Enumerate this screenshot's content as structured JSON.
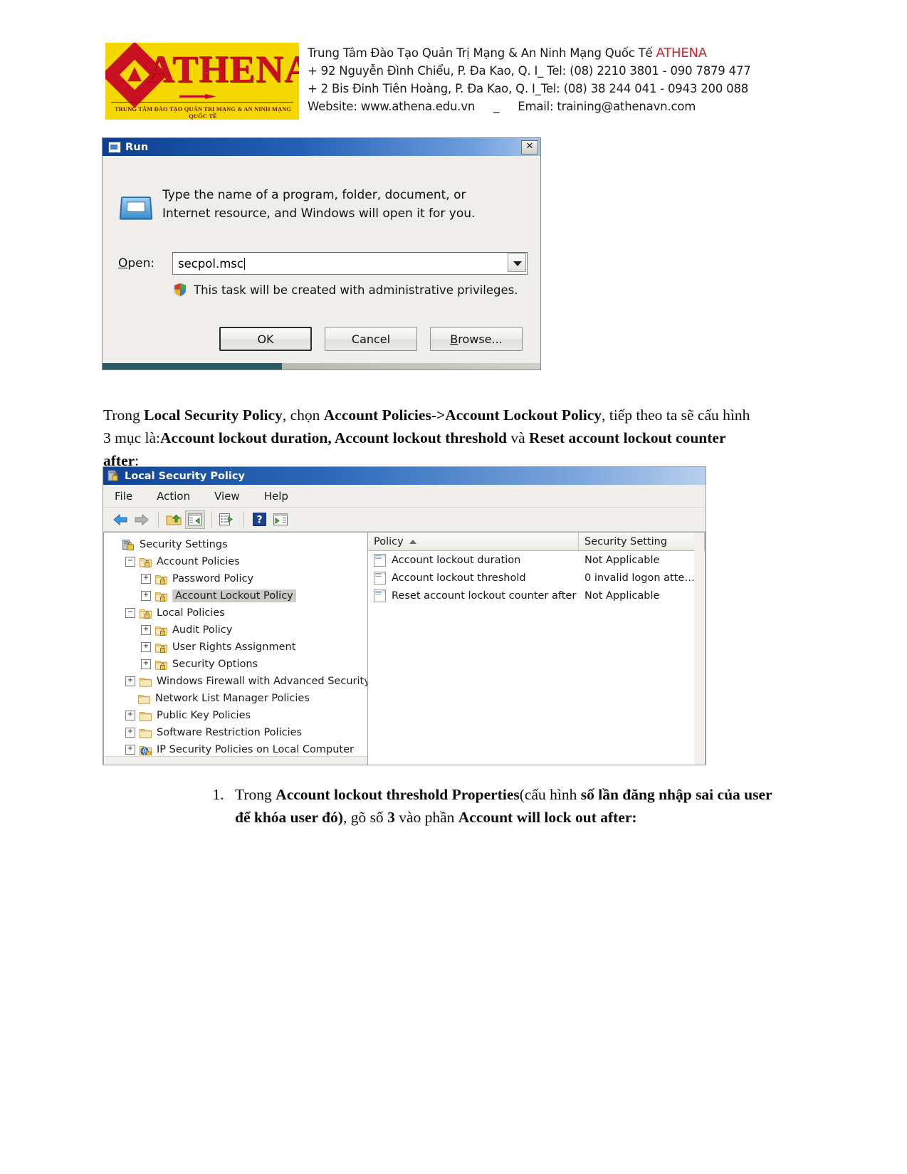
{
  "letterhead": {
    "logo": {
      "wordmark": "ATHENA",
      "tagline": "TRUNG TÂM ĐÀO TẠO QUẢN TRỊ MẠNG & AN NINH MẠNG QUỐC TẾ",
      "brand_color": "#c81020",
      "background_color": "#f5d800"
    },
    "line1_prefix": "Trung Tâm Đào Tạo Quản Trị Mạng & An Ninh Mạng Quốc Tế ",
    "line1_brand": "ATHENA",
    "line2": "+ 92 Nguyễn Đình Chiểu, P. Đa Kao, Q. I_ Tel: (08) 2210 3801 -  090 7879 477",
    "line3": "+ 2 Bis Đinh Tiên Hoàng, P. Đa Kao, Q. I_Tel: (08) 38 244 041 - 0943 200 088",
    "line4_website": "Website: www.athena.edu.vn",
    "line4_sep": "_",
    "line4_email": "Email: training@athenavn.com"
  },
  "run_dialog": {
    "title": "Run",
    "close_label": "✕",
    "description": "Type the name of a program, folder, document, or Internet resource, and Windows will open it for you.",
    "open_label_pre": "O",
    "open_label_post": "pen:",
    "open_value": "secpol.msc",
    "uac_text": "This task will be created with administrative privileges.",
    "buttons": {
      "ok": "OK",
      "cancel": "Cancel",
      "browse_pre": "B",
      "browse_post": "rowse..."
    }
  },
  "paragraph1": {
    "t1": "Trong ",
    "b1": "Local Security Policy",
    "t2": ", chọn ",
    "b2": "Account Policies->Account Lockout Policy",
    "t3": ", tiếp theo ta sẽ cấu hình 3 mục là:",
    "b3": "Account lockout duration, Account lockout threshold",
    "t4": " và ",
    "b4": "Reset account lockout counter after",
    "t5": ":"
  },
  "lsp_window": {
    "title": "Local Security Policy",
    "menus": [
      "File",
      "Action",
      "View",
      "Help"
    ],
    "toolbar": [
      {
        "name": "back-icon",
        "label": "Back"
      },
      {
        "name": "forward-icon",
        "label": "Forward"
      },
      {
        "name": "up-folder-icon",
        "label": "Up One Level"
      },
      {
        "name": "show-hide-tree-icon",
        "label": "Show/Hide Console Tree"
      },
      {
        "name": "export-list-icon",
        "label": "Export List"
      },
      {
        "name": "help-icon",
        "label": "Help"
      },
      {
        "name": "show-action-pane-icon",
        "label": "Show/Hide Action Pane"
      }
    ],
    "tree": [
      {
        "label": "Security Settings",
        "indent": 0,
        "toggle": "none",
        "icon": "root",
        "selected": false
      },
      {
        "label": "Account Policies",
        "indent": 1,
        "toggle": "minus",
        "icon": "policy-folder",
        "selected": false
      },
      {
        "label": "Password Policy",
        "indent": 2,
        "toggle": "plus",
        "icon": "policy-folder",
        "selected": false
      },
      {
        "label": "Account Lockout Policy",
        "indent": 2,
        "toggle": "plus",
        "icon": "policy-folder",
        "selected": true
      },
      {
        "label": "Local Policies",
        "indent": 1,
        "toggle": "minus",
        "icon": "policy-folder",
        "selected": false
      },
      {
        "label": "Audit Policy",
        "indent": 2,
        "toggle": "plus",
        "icon": "policy-folder",
        "selected": false
      },
      {
        "label": "User Rights Assignment",
        "indent": 2,
        "toggle": "plus",
        "icon": "policy-folder",
        "selected": false
      },
      {
        "label": "Security Options",
        "indent": 2,
        "toggle": "plus",
        "icon": "policy-folder",
        "selected": false
      },
      {
        "label": "Windows Firewall with Advanced Security",
        "indent": 1,
        "toggle": "plus",
        "icon": "plain-folder",
        "selected": false
      },
      {
        "label": "Network List Manager Policies",
        "indent": 1,
        "toggle": "none",
        "icon": "plain-folder",
        "selected": false
      },
      {
        "label": "Public Key Policies",
        "indent": 1,
        "toggle": "plus",
        "icon": "plain-folder",
        "selected": false
      },
      {
        "label": "Software Restriction Policies",
        "indent": 1,
        "toggle": "plus",
        "icon": "plain-folder",
        "selected": false
      },
      {
        "label": "IP Security Policies on Local Computer",
        "indent": 1,
        "toggle": "plus",
        "icon": "ipsec-folder",
        "selected": false
      }
    ],
    "list": {
      "columns": [
        "Policy",
        "Security Setting"
      ],
      "sort_column": "Policy",
      "sort_direction": "asc",
      "rows": [
        {
          "policy": "Account lockout duration",
          "setting": "Not Applicable"
        },
        {
          "policy": "Account lockout threshold",
          "setting": "0 invalid logon atte…"
        },
        {
          "policy": "Reset account lockout counter after",
          "setting": "Not Applicable"
        }
      ]
    }
  },
  "numbered_list": [
    {
      "number": "1.",
      "t1": "Trong ",
      "b1": "Account lockout threshold Properties",
      "t2": "(cấu hình ",
      "b2": "số lần đăng nhập sai của user để khóa user đó)",
      "t3": ", gõ số ",
      "b3": "3",
      "t4": " vào phần ",
      "b4": "Account will lock out after:"
    }
  ]
}
